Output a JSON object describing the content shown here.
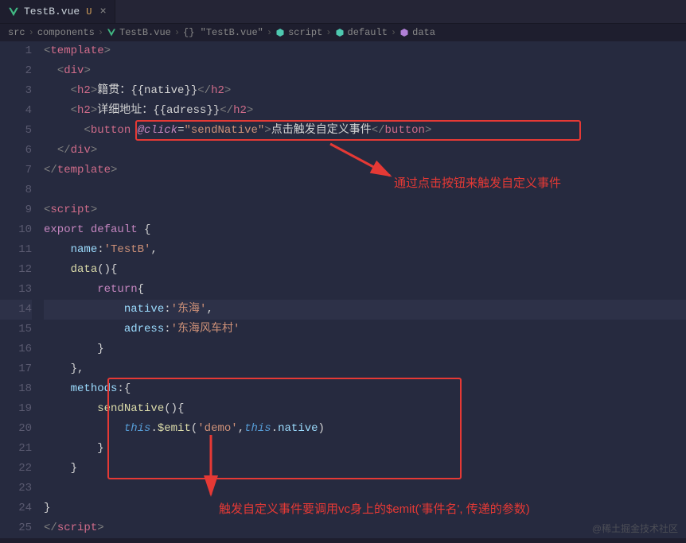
{
  "tab": {
    "name": "TestB.vue",
    "modified": "U",
    "close": "×"
  },
  "breadcrumb": {
    "items": [
      "src",
      "components",
      "TestB.vue",
      "{} \"TestB.vue\"",
      "script",
      "default",
      "data"
    ],
    "sep": "›"
  },
  "lines": [
    "1",
    "2",
    "3",
    "4",
    "5",
    "6",
    "7",
    "8",
    "9",
    "10",
    "11",
    "12",
    "13",
    "14",
    "15",
    "16",
    "17",
    "18",
    "19",
    "20",
    "21",
    "22",
    "23",
    "24",
    "25"
  ],
  "code": {
    "l1_tag": "template",
    "l2_tag": "div",
    "l3_tag": "h2",
    "l3_txt": "籍贯：{{native}}",
    "l4_tag": "h2",
    "l4_txt": "详细地址：{{adress}}",
    "l5_tag": "button",
    "l5_attr": "@click",
    "l5_val": "sendNative",
    "l5_txt": "点击触发自定义事件",
    "l9_tag": "script",
    "l10_export": "export",
    "l10_default": "default",
    "l11_name": "name",
    "l11_val": "'TestB'",
    "l12_data": "data",
    "l13_return": "return",
    "l14_native": "native",
    "l14_val": "'东海'",
    "l15_adress": "adress",
    "l15_val": "'东海风车村'",
    "l18_methods": "methods",
    "l19_fn": "sendNative",
    "l20_this": "this",
    "l20_emit": "$emit",
    "l20_arg1": "'demo'",
    "l20_this2": "this",
    "l20_native": "native"
  },
  "annotations": {
    "anno1": "通过点击按钮来触发自定义事件",
    "anno2": "触发自定义事件要调用vc身上的$emit('事件名', 传递的参数)"
  },
  "watermark": "@稀土掘金技术社区"
}
